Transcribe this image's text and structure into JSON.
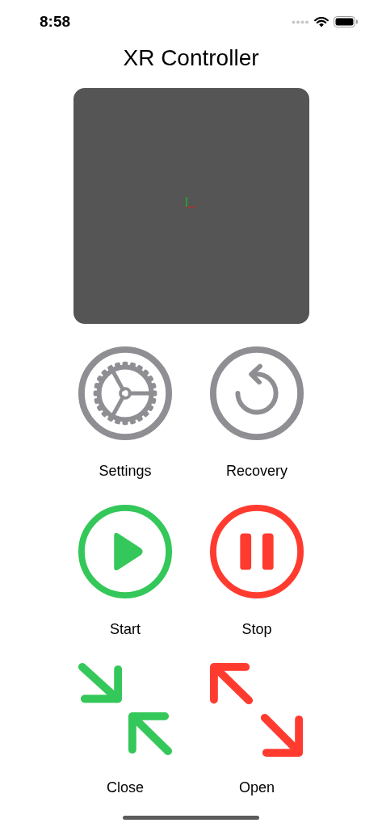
{
  "status_bar": {
    "time": "8:58"
  },
  "title": "XR Controller",
  "buttons": [
    {
      "kind": "settings",
      "label": "Settings",
      "color": "#8e8e93"
    },
    {
      "kind": "recovery",
      "label": "Recovery",
      "color": "#8e8e93"
    },
    {
      "kind": "start",
      "label": "Start",
      "color": "#34c759"
    },
    {
      "kind": "stop",
      "label": "Stop",
      "color": "#ff3b30"
    },
    {
      "kind": "close",
      "label": "Close",
      "color": "#34c759"
    },
    {
      "kind": "open",
      "label": "Open",
      "color": "#ff3b30"
    }
  ]
}
